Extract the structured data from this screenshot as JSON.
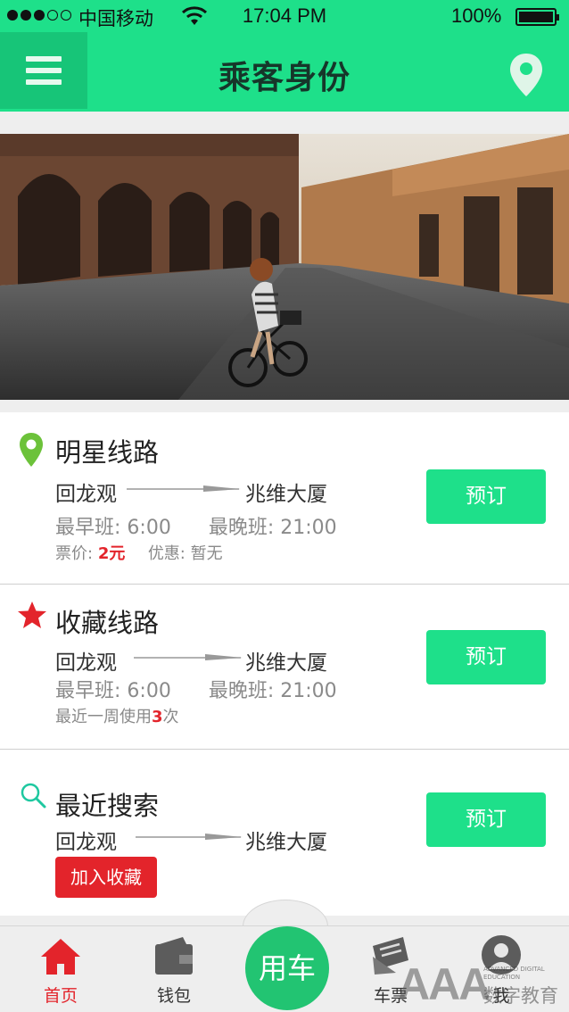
{
  "status_bar": {
    "carrier": "中国移动",
    "time": "17:04 PM",
    "battery": "100%"
  },
  "header": {
    "title": "乘客身份",
    "menu_icon": "hamburger-menu-icon",
    "location_icon": "map-pin-icon"
  },
  "cards": {
    "star_route": {
      "title": "明星线路",
      "from": "回龙观",
      "to": "兆维大厦",
      "earliest_label": "最早班:",
      "earliest": "6:00",
      "latest_label": "最晚班:",
      "latest": "21:00",
      "price_label": "票价:",
      "price": "2元",
      "discount_label": "优惠:",
      "discount": "暂无",
      "book": "预订"
    },
    "favorite_route": {
      "title": "收藏线路",
      "from": "回龙观",
      "to": "兆维大厦",
      "earliest_label": "最早班:",
      "earliest": "6:00",
      "latest_label": "最晚班:",
      "latest": "21:00",
      "usage_prefix": "最近一周使用",
      "usage_count": "3",
      "usage_suffix": "次",
      "book": "预订"
    },
    "recent_search": {
      "title": "最近搜索",
      "from": "回龙观",
      "to": "兆维大厦",
      "add_favorite": "加入收藏",
      "book": "预订"
    }
  },
  "tab_bar": {
    "home": "首页",
    "wallet": "钱包",
    "ride": "用车",
    "tickets": "车票",
    "me": "我"
  },
  "watermark": {
    "logo": "AAA",
    "line1": "ADVANCED DIGITAL",
    "line2": "EDUCATION",
    "cn": "数字教育"
  },
  "colors": {
    "brand_green": "#1ee08a",
    "accent_red": "#e3242b"
  }
}
